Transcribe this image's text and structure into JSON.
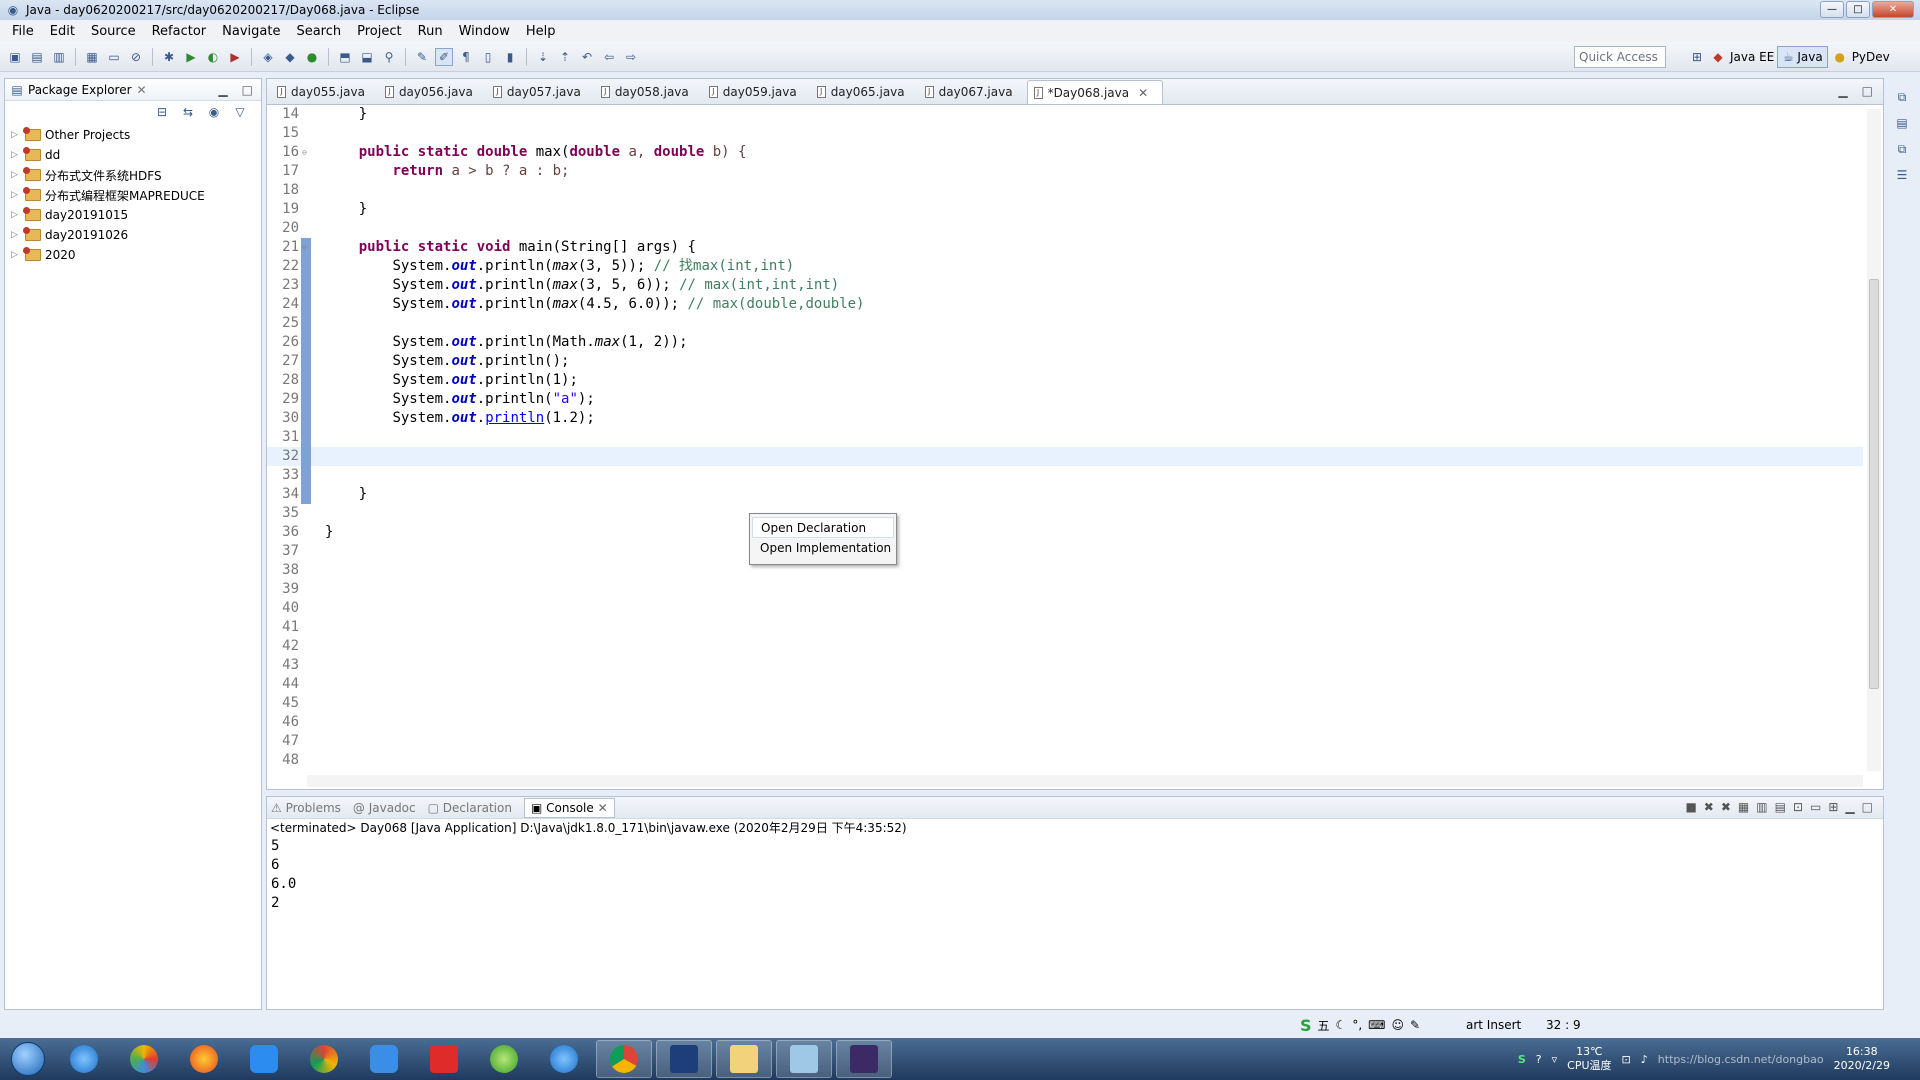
{
  "window": {
    "title": "Java - day0620200217/src/day0620200217/Day068.java - Eclipse"
  },
  "menu": [
    "File",
    "Edit",
    "Source",
    "Refactor",
    "Navigate",
    "Search",
    "Project",
    "Run",
    "Window",
    "Help"
  ],
  "quick_access": {
    "placeholder": "Quick Access"
  },
  "perspectives": [
    "Java EE",
    "Java",
    "PyDev"
  ],
  "package_explorer": {
    "title": "Package Explorer",
    "items": [
      "Other Projects",
      "dd",
      "分布式文件系统HDFS",
      "分布式编程框架MAPREDUCE",
      "day20191015",
      "day20191026",
      "2020"
    ]
  },
  "editor": {
    "tabs": [
      "day055.java",
      "day056.java",
      "day057.java",
      "day058.java",
      "day059.java",
      "day065.java",
      "day067.java",
      "*Day068.java"
    ],
    "active_tab": 7,
    "line_numbers": [
      "14",
      "15",
      "16",
      "17",
      "18",
      "19",
      "20",
      "21",
      "22",
      "23",
      "24",
      "25",
      "26",
      "27",
      "28",
      "29",
      "30",
      "31",
      "32",
      "33",
      "34",
      "35",
      "36",
      "37",
      "38",
      "39",
      "40",
      "41",
      "42",
      "43",
      "44",
      "45",
      "46",
      "47",
      "48"
    ],
    "code": {
      "l14": "    }",
      "l16_kw": "public static double",
      "l16_rest": " max(",
      "l16_t1": "double",
      "l16_a": " a, ",
      "l16_t2": "double",
      "l16_b": " b) {",
      "l17_kw": "return",
      "l17_rest": " a > b ? a : b;",
      "l19": "    }",
      "l21_kw": "public static void",
      "l21_rest": " main(String[] args) {",
      "l22_a": "System.",
      "l22_b": "out",
      "l22_c": ".println(",
      "l22_d": "max",
      "l22_e": "(3, 5)); ",
      "l22_cm": "// 找max(int,int)",
      "l23_e": "(3, 5, 6)); ",
      "l23_cm": "// max(int,int,int)",
      "l24_e": "(4.5, 6.0)); ",
      "l24_cm": "// max(double,double)",
      "l26_c": ".println(Math.",
      "l26_e": "(1, 2));",
      "l27_c": ".println();",
      "l28_c": ".println(1);",
      "l29_c": ".println(",
      "l29_s": "\"a\"",
      "l29_e": ");",
      "l30_link": "println",
      "l30_e": "(1.2);",
      "l34": "    }",
      "l36": "}"
    }
  },
  "context_menu": [
    "Open Declaration",
    "Open Implementation"
  ],
  "console": {
    "tabs": [
      "Problems",
      "Javadoc",
      "Declaration",
      "Console"
    ],
    "header": "<terminated> Day068 [Java Application] D:\\Java\\jdk1.8.0_171\\bin\\javaw.exe (2020年2月29日 下午4:35:52)",
    "output": [
      "5",
      "6",
      "6.0",
      "2"
    ]
  },
  "statusbar": {
    "mode": "art Insert",
    "position": "32 : 9",
    "ime": "五"
  },
  "tray": {
    "temperature": "13℃",
    "temp_label": "CPU温度",
    "time": "16:38",
    "date": "2020/2/29",
    "watermark": "https://blog.csdn.net/dongbao"
  }
}
